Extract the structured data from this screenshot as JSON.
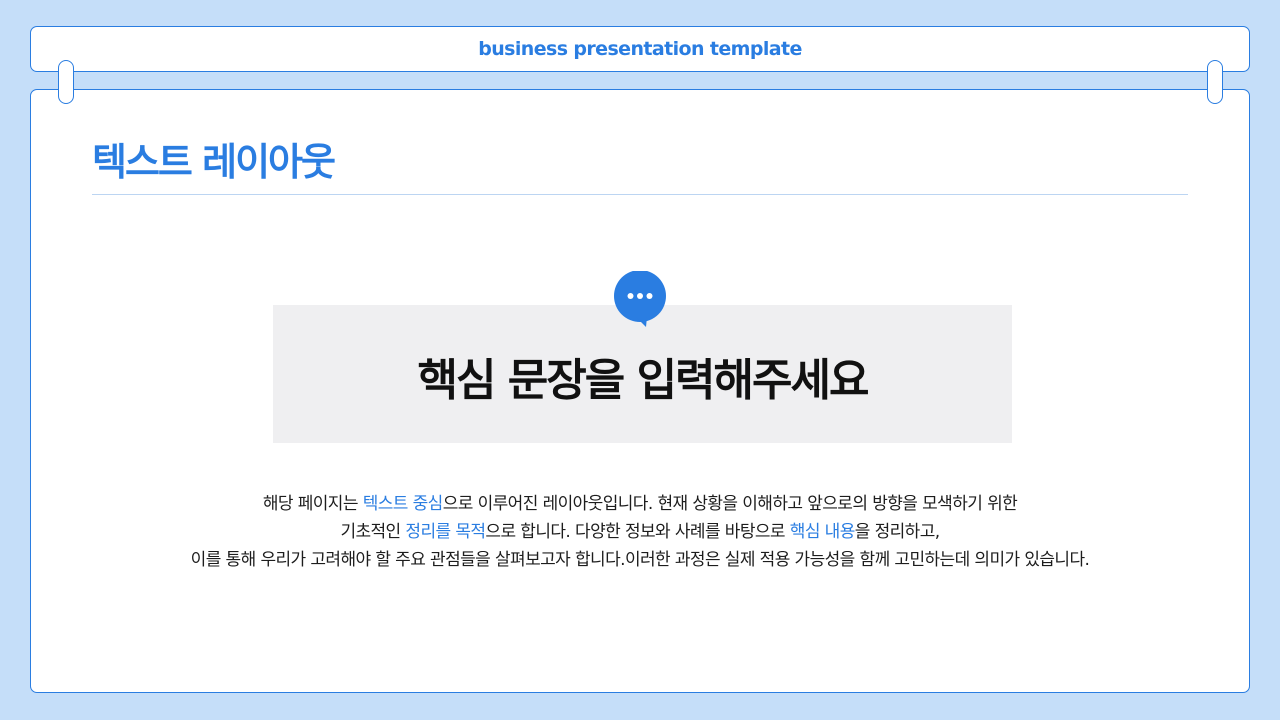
{
  "header": {
    "title": "business presentation template"
  },
  "page": {
    "title": "텍스트 레이아웃"
  },
  "key_box": {
    "sentence": "핵심 문장을 입력해주세요"
  },
  "description": {
    "line1": {
      "p1": "해당 페이지는 ",
      "hl1": "텍스트 중심",
      "p2": "으로 이루어진 레이아웃입니다. 현재 상황을 이해하고 앞으로의 방향을 모색하기 위한"
    },
    "line2": {
      "p1": "기초적인 ",
      "hl1": "정리를 목적",
      "p2": "으로 합니다. 다양한 정보와 사례를 바탕으로 ",
      "hl2": "핵심 내용",
      "p3": "을 정리하고,"
    },
    "line3": {
      "p1": "이를 통해 우리가 고려해야 할 주요 관점들을 살펴보고자 합니다.이러한 과정은 실제 적용 가능성을 함께 고민하는데 의미가 있습니다."
    }
  },
  "colors": {
    "accent": "#2a7de1",
    "background": "#c5def9",
    "key_box": "#efeff1"
  },
  "icons": {
    "speech_bubble": "speech-bubble-icon"
  }
}
